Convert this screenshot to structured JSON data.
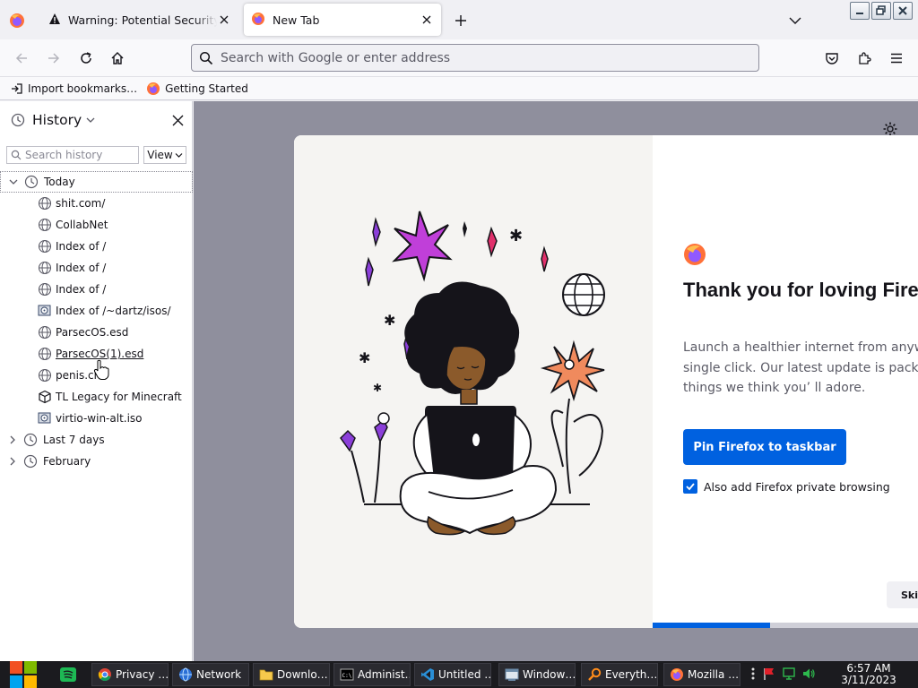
{
  "tabs": [
    {
      "title": "Warning: Potential Security Risk Ahead",
      "icon": "warning-icon",
      "active": false
    },
    {
      "title": "New Tab",
      "icon": "firefox-icon",
      "active": true
    }
  ],
  "navbar": {
    "url_placeholder": "Search with Google or enter address"
  },
  "bookmarks": [
    {
      "label": "Import bookmarks…",
      "icon": "import-icon"
    },
    {
      "label": "Getting Started",
      "icon": "firefox-icon"
    }
  ],
  "sidebar": {
    "title": "History",
    "search_placeholder": "Search history",
    "view_label": "View",
    "groups": [
      {
        "label": "Today",
        "expanded": true
      },
      {
        "label": "Last 7 days",
        "expanded": false
      },
      {
        "label": "February",
        "expanded": false
      }
    ],
    "items": [
      {
        "label": "shit.com/",
        "icon": "globe-icon"
      },
      {
        "label": "CollabNet",
        "icon": "globe-icon"
      },
      {
        "label": "Index of /",
        "icon": "globe-icon"
      },
      {
        "label": "Index of /",
        "icon": "globe-icon"
      },
      {
        "label": "Index of /",
        "icon": "globe-icon"
      },
      {
        "label": "Index of /~dartz/isos/",
        "icon": "disc-icon"
      },
      {
        "label": "ParsecOS.esd",
        "icon": "globe-icon"
      },
      {
        "label": "ParsecOS(1).esd",
        "icon": "globe-icon"
      },
      {
        "label": "penis.ch",
        "icon": "globe-icon"
      },
      {
        "label": "TL Legacy for Minecraft",
        "icon": "cube-icon"
      },
      {
        "label": "virtio-win-alt.iso",
        "icon": "disc-icon"
      }
    ]
  },
  "modal": {
    "title": "Thank you for loving Firefox",
    "body_lines": [
      "Launch a healthier internet from anywh",
      "single click. Our latest update is packe",
      "things we think you’ ll adore."
    ],
    "primary_button": "Pin Firefox to taskbar",
    "checkbox_label": "Also add Firefox private browsing",
    "checkbox_checked": true,
    "skip_label": "Skip",
    "progress_fraction": 0.41
  },
  "taskbar": {
    "items": [
      {
        "label": "Privacy …",
        "icon": "chrome-icon"
      },
      {
        "label": "Network",
        "icon": "network-icon"
      },
      {
        "label": "Downlo…",
        "icon": "folder-icon"
      },
      {
        "label": "Administ…",
        "icon": "cmd-icon"
      },
      {
        "label": "Untitled …",
        "icon": "vscode-icon"
      },
      {
        "label": "Window…",
        "icon": "window-icon"
      },
      {
        "label": "Everyth…",
        "icon": "search-icon"
      },
      {
        "label": "Mozilla …",
        "icon": "firefox-icon"
      }
    ],
    "time": "6:57 AM",
    "date": "3/11/2023"
  },
  "colors": {
    "accent": "#0061e0",
    "content_bg": "#8f8f9d",
    "taskbar": "#1b1b1f"
  }
}
